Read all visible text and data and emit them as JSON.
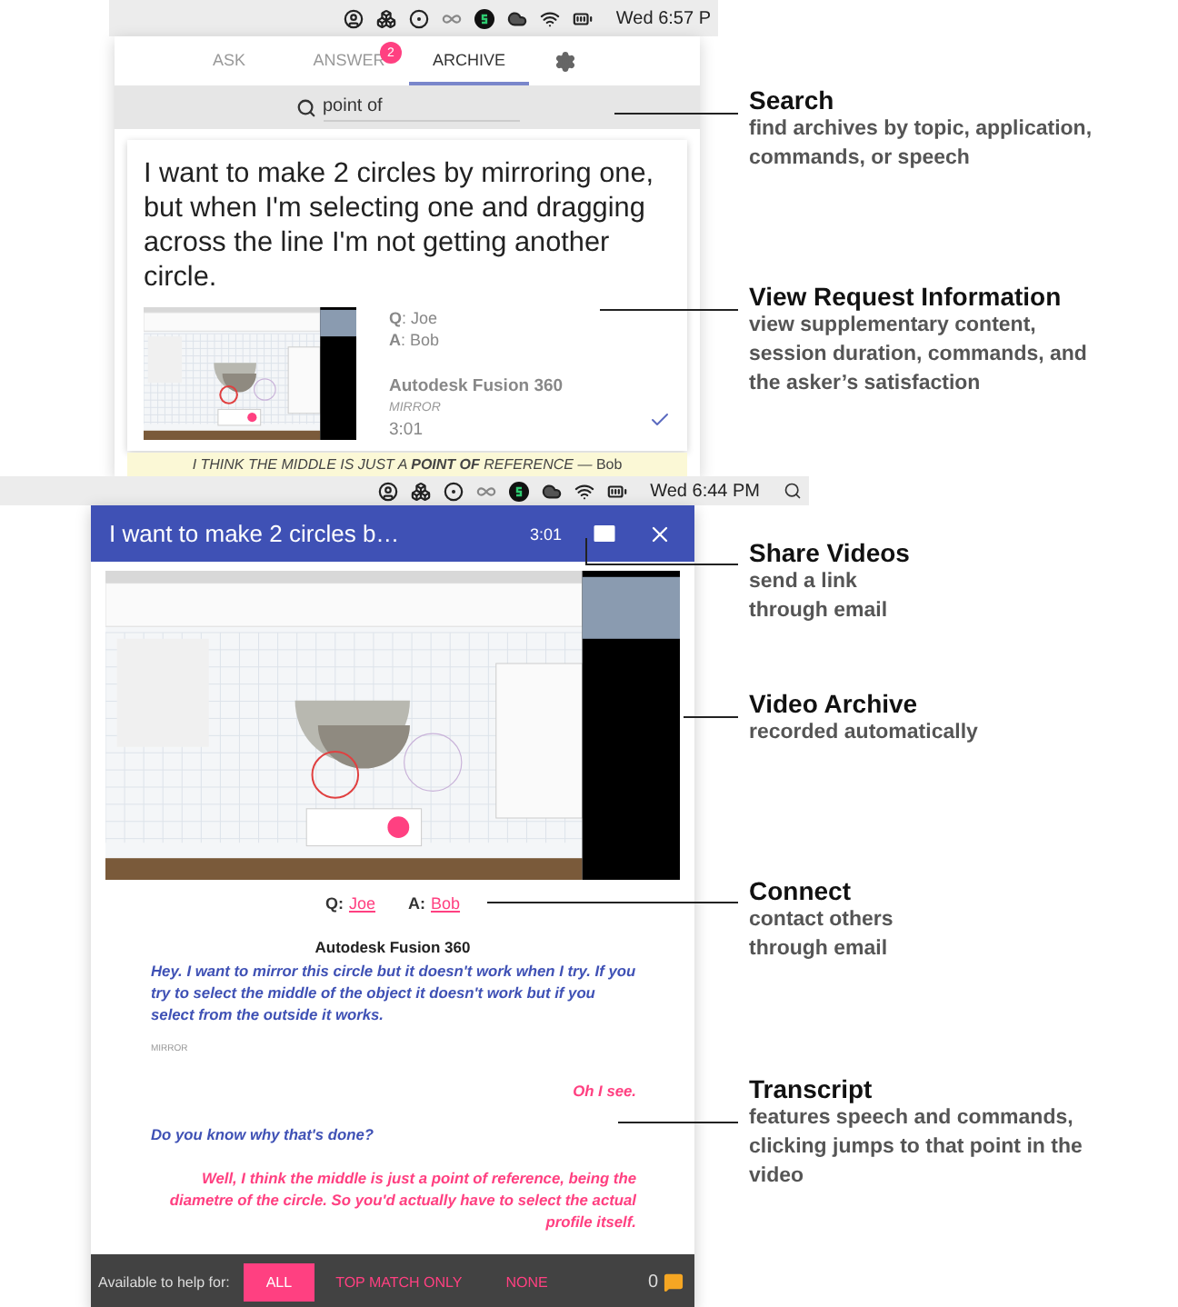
{
  "top_panel": {
    "menu_bar": {
      "clock": "Wed 6:57 P"
    },
    "tabs": [
      {
        "label": "ASK",
        "selected": false
      },
      {
        "label": "ANSWER",
        "selected": false,
        "badge": "2"
      },
      {
        "label": "ARCHIVE",
        "selected": true
      }
    ],
    "search": {
      "value": "point of"
    },
    "result": {
      "question": "I want to make 2 circles by mirroring one, but when I'm selecting one and dragging across the line I'm not getting another circle.",
      "asker": "**Q**: Joe",
      "answerer": "**A**: Bob",
      "application": "Autodesk Fusion 360",
      "command": "MIRROR",
      "duration": "3:01",
      "satisfied": true,
      "snippet": "I THINK THE MIDDLE IS JUST A **POINT OF** REFERENCE —",
      "snippet_author": "Bob"
    }
  },
  "video_panel": {
    "menu_bar": {
      "clock": "Wed 6:44 PM"
    },
    "title": "I want to make 2 circles b…",
    "duration": "3:01",
    "asker_label": "Q:",
    "asker": "Joe",
    "answerer_label": "A:",
    "answerer": "Bob",
    "application": "Autodesk Fusion 360",
    "transcript": [
      {
        "kind": "asker",
        "text": "Hey. I want to mirror this circle but it doesn't work when I try. If you try to select the middle of the object it doesn't work but if you select from the outside it works."
      },
      {
        "kind": "command",
        "text": "MIRROR"
      },
      {
        "kind": "helper",
        "text": "Oh I see."
      },
      {
        "kind": "asker",
        "text": "Do you know why that's done?"
      },
      {
        "kind": "helper",
        "text": "Well, I think the middle is just a point of reference, being the diametre of the circle. So you'd actually have to select the actual profile itself."
      }
    ],
    "footer": {
      "label": "Available to help for:",
      "options": [
        {
          "label": "ALL",
          "selected": true
        },
        {
          "label": "TOP MATCH ONLY",
          "selected": false
        },
        {
          "label": "NONE",
          "selected": false
        }
      ],
      "count": "0"
    }
  },
  "annotations": [
    {
      "title": "Search",
      "description": "find archives by topic, application, commands, or speech"
    },
    {
      "title": "View Request Information",
      "description": "view supplementary content, session duration, commands, and the asker’s satisfaction"
    },
    {
      "title": "Share Videos",
      "description": "send a link through email"
    },
    {
      "title": "Video Archive",
      "description": "recorded automatically"
    },
    {
      "title": "Connect",
      "description": "contact others through email"
    },
    {
      "title": "Transcript",
      "description": "features speech and commands, clicking jumps to that point in the video"
    }
  ]
}
